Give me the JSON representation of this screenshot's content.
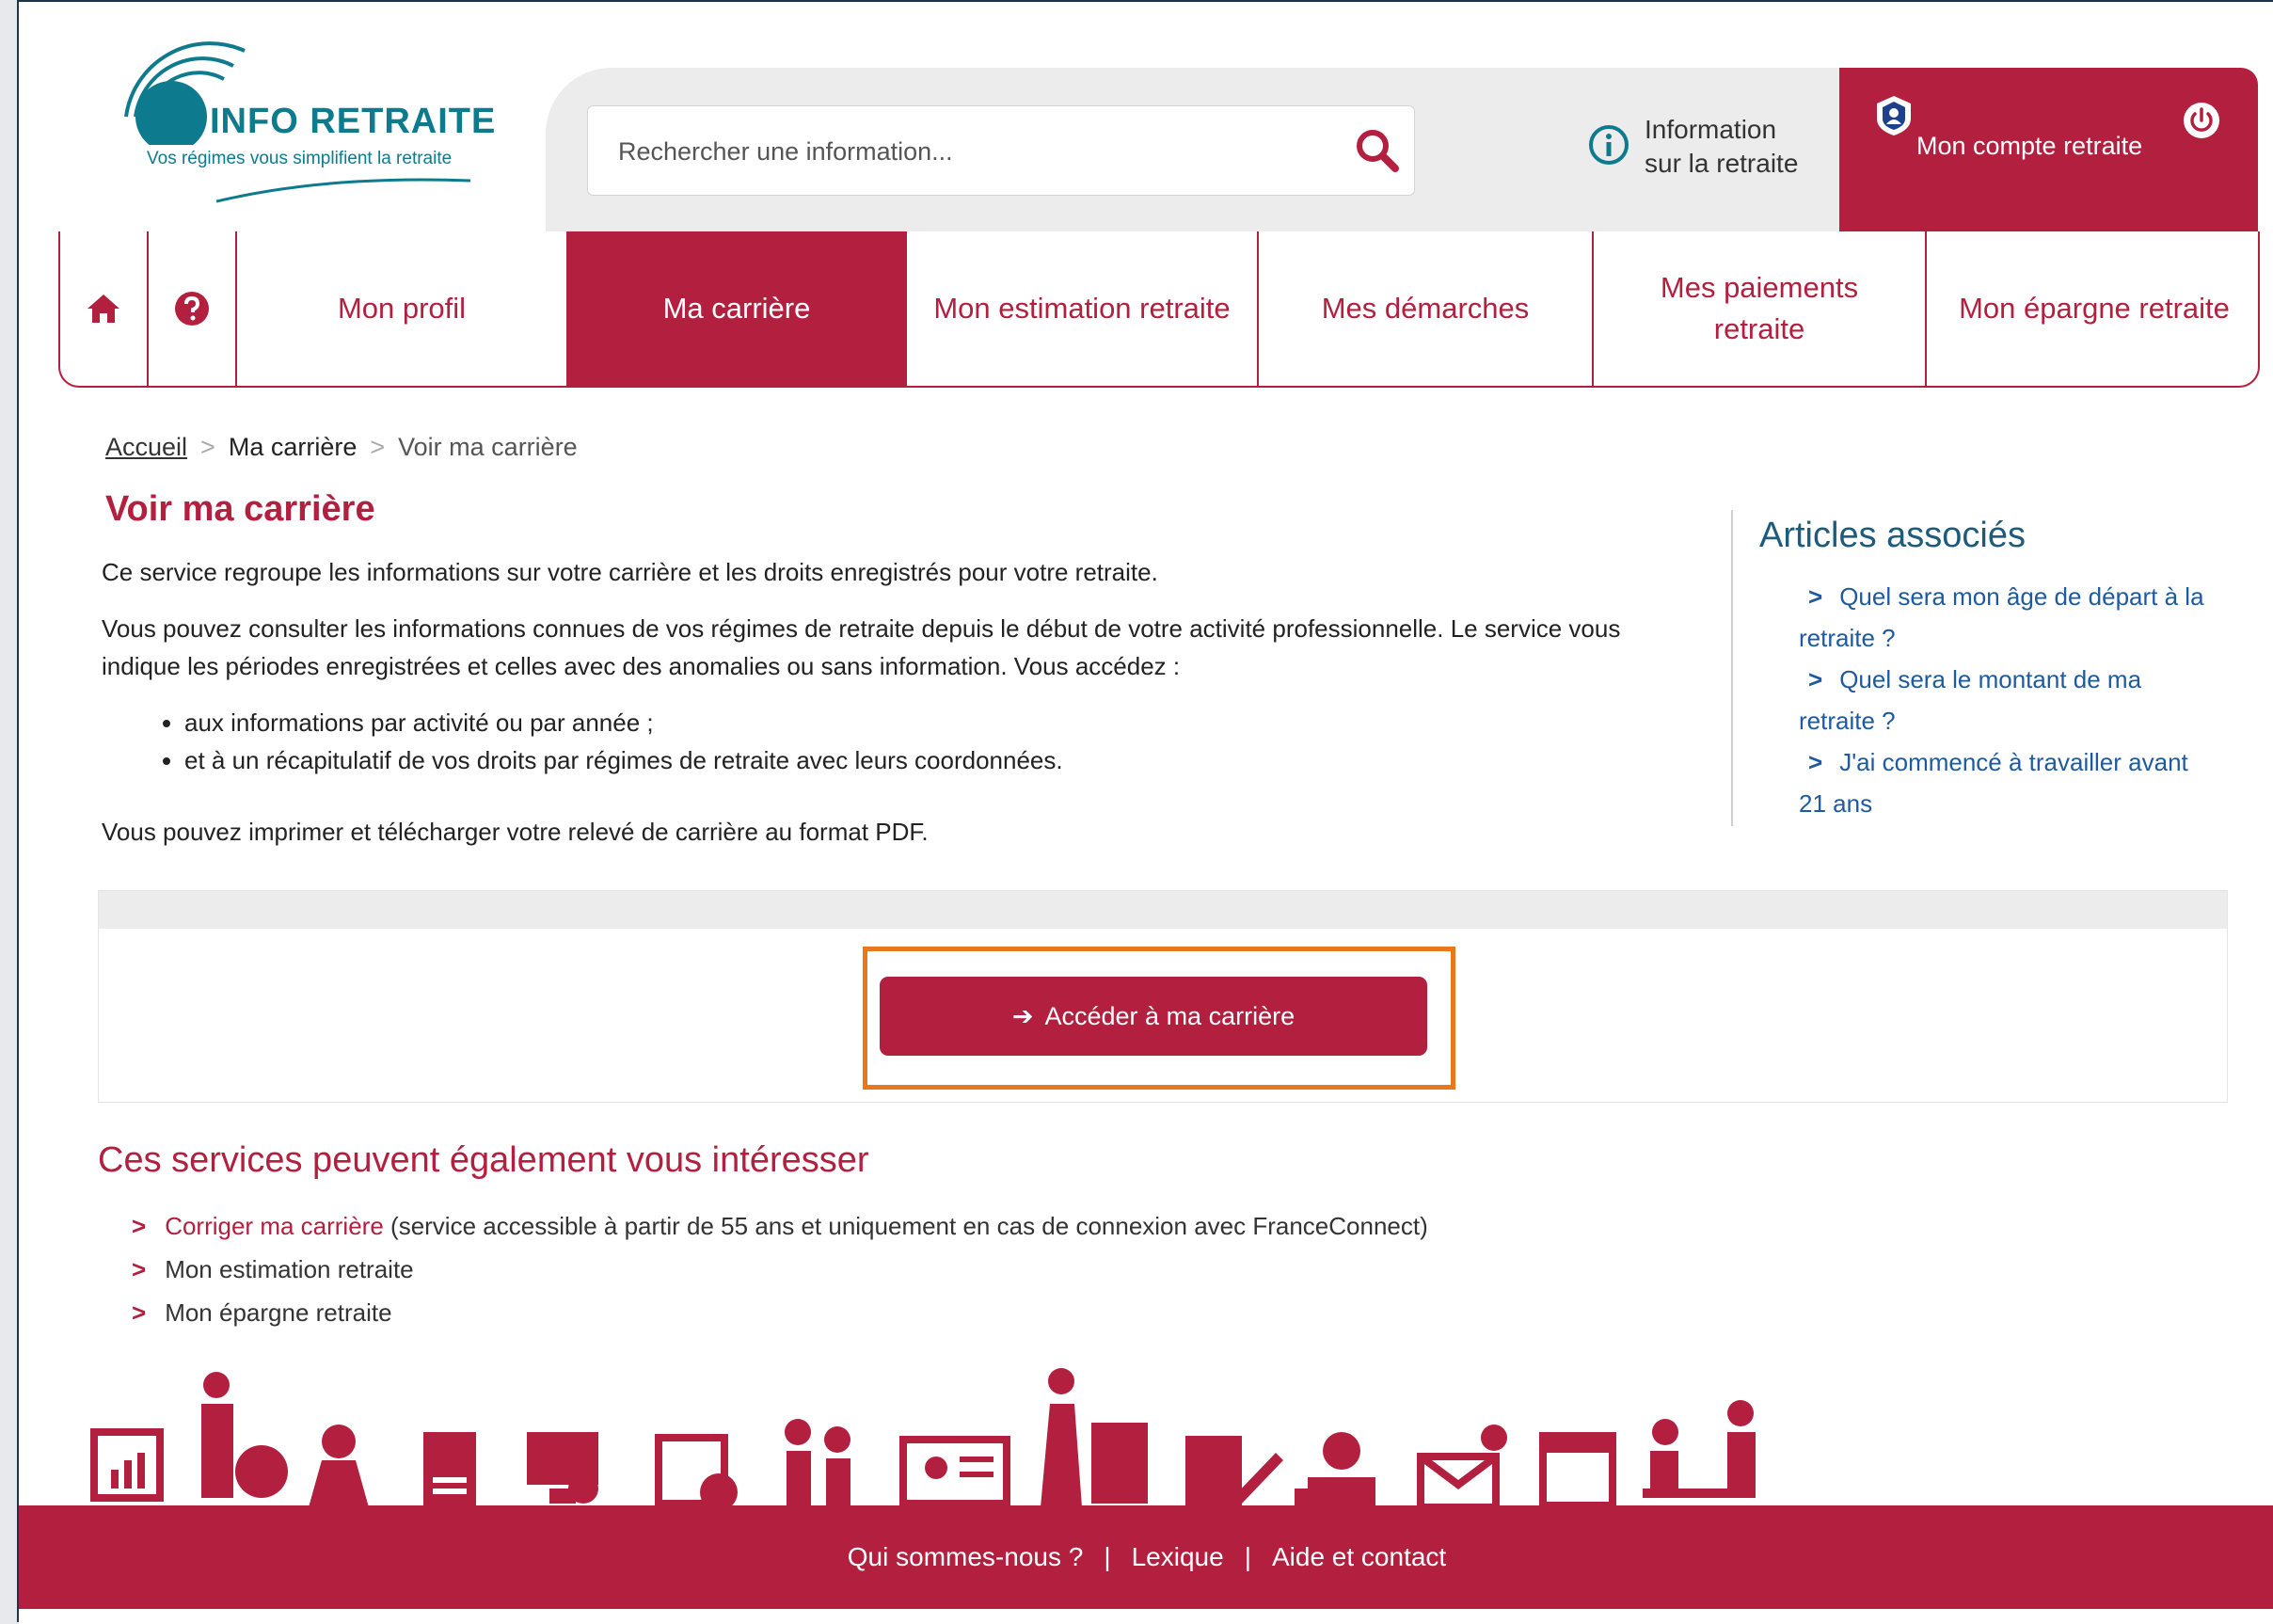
{
  "header": {
    "logo_title": "INFO RETRAITE",
    "logo_tagline": "Vos régimes vous simplifient la retraite",
    "search_placeholder": "Rechercher une information...",
    "info_line1": "Information",
    "info_line2": "sur la retraite",
    "account_label": "Mon compte retraite"
  },
  "nav": {
    "items": [
      {
        "label": "Mon profil"
      },
      {
        "label": "Ma carrière"
      },
      {
        "label": "Mon estimation retraite"
      },
      {
        "label": "Mes démarches"
      },
      {
        "label": "Mes paiements retraite"
      },
      {
        "label": "Mon épargne retraite"
      }
    ]
  },
  "breadcrumb": {
    "home": "Accueil",
    "middle": "Ma carrière",
    "current": "Voir ma carrière"
  },
  "main": {
    "title": "Voir ma carrière",
    "intro": "Ce service regroupe les informations sur votre carrière et les droits enregistrés pour votre retraite.",
    "description": "Vous pouvez consulter les informations connues de vos régimes de retraite depuis le début de votre activité professionnelle. Le service vous indique les périodes enregistrées et celles avec des anomalies ou sans information. Vous accédez :",
    "bullets": [
      "aux informations par activité ou par année ;",
      "et à un récapitulatif de vos droits par régimes de retraite avec leurs coordonnées."
    ],
    "print_note": "Vous pouvez imprimer et télécharger votre relevé de carrière au format PDF.",
    "button_label": "Accéder à ma carrière"
  },
  "aside": {
    "title": "Articles associés",
    "links": [
      "Quel sera mon âge de départ à la retraite ?",
      "Quel sera le montant de ma retraite ?",
      "J'ai commencé à travailler avant 21 ans"
    ]
  },
  "services": {
    "title": "Ces services peuvent également vous intéresser",
    "item1_link": "Corriger ma carrière",
    "item1_rest": "(service accessible à partir de 55 ans et uniquement en cas de connexion avec FranceConnect)",
    "item2": "Mon estimation retraite",
    "item3": "Mon épargne retraite"
  },
  "footer": {
    "links": [
      "Qui sommes-nous ?",
      "Lexique",
      "Aide et contact"
    ],
    "separator": "|"
  },
  "colors": {
    "brand_red": "#b3203f",
    "logo_teal": "#0e7a8e",
    "link_blue": "#1e5aa0",
    "highlight_orange": "#e8781a"
  },
  "icons": {
    "search": "search-icon",
    "info": "info-icon",
    "account": "shield-user-icon",
    "power": "power-icon",
    "home": "home-icon",
    "help": "question-circle-icon",
    "button_arrow": "arrow-right-icon"
  }
}
